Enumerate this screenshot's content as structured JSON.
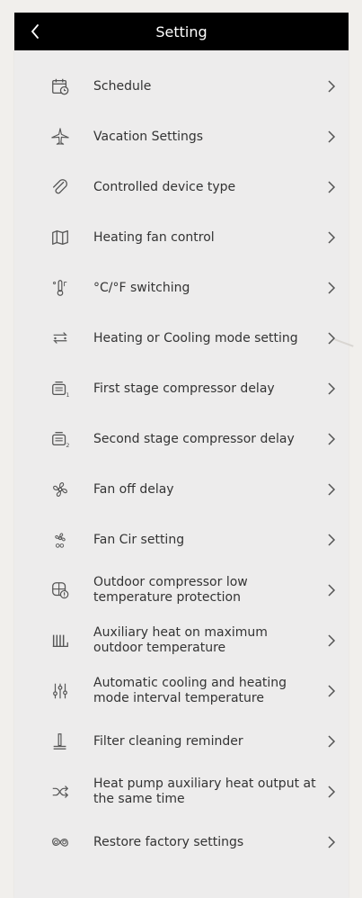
{
  "header": {
    "title": "Setting",
    "back_icon": "chevron-left-icon"
  },
  "items": [
    {
      "label": "Schedule",
      "icon": "calendar-clock-icon"
    },
    {
      "label": "Vacation Settings",
      "icon": "airplane-icon"
    },
    {
      "label": "Controlled device type",
      "icon": "paperclip-icon"
    },
    {
      "label": "Heating fan control",
      "icon": "map-icon"
    },
    {
      "label": "°C/°F switching",
      "icon": "thermometer-icon"
    },
    {
      "label": "Heating or Cooling mode setting",
      "icon": "mode-switch-icon"
    },
    {
      "label": "First stage compressor delay",
      "icon": "compressor-1-icon"
    },
    {
      "label": "Second stage compressor delay",
      "icon": "compressor-2-icon"
    },
    {
      "label": "Fan off delay",
      "icon": "fan-icon"
    },
    {
      "label": "Fan Cir setting",
      "icon": "fan-circulate-icon"
    },
    {
      "label": "Outdoor compressor low temperature protection",
      "icon": "outdoor-compressor-icon"
    },
    {
      "label": "Auxiliary heat on maximum outdoor temperature",
      "icon": "radiator-icon"
    },
    {
      "label": "Automatic cooling and heating mode interval temperature",
      "icon": "sliders-icon"
    },
    {
      "label": "Filter cleaning reminder",
      "icon": "filter-icon"
    },
    {
      "label": "Heat pump auxiliary heat output at the same time",
      "icon": "shuffle-icon"
    },
    {
      "label": "Restore factory settings",
      "icon": "restore-icon"
    }
  ],
  "colors": {
    "header_bg": "#000000",
    "page_bg": "#edecec",
    "text": "#333333",
    "icon": "#555555"
  }
}
